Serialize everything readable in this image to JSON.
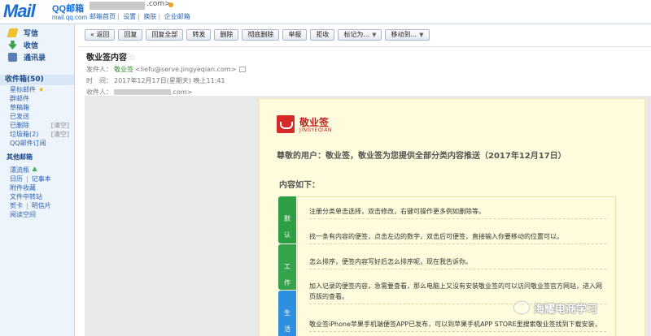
{
  "header": {
    "logo_text": "Mail",
    "logo_qq": "QQ邮箱",
    "logo_domain": "mail.qq.com",
    "account_suffix": ".com>",
    "links": [
      "邮箱首页",
      "设置",
      "换肤",
      "企业邮箱"
    ]
  },
  "sidebar": {
    "actions": [
      {
        "label": "写信",
        "icon": "pencil-icon"
      },
      {
        "label": "收信",
        "icon": "inbox-arrow-icon"
      },
      {
        "label": "通讯录",
        "icon": "contacts-icon"
      }
    ],
    "inbox_label": "收件箱(50)",
    "folders": [
      {
        "label": "星标邮件"
      },
      {
        "label": "群邮件"
      },
      {
        "label": "草稿箱"
      },
      {
        "label": "已发送"
      },
      {
        "label": "已删除",
        "clear": "[清空]"
      },
      {
        "label": "垃圾箱(2)",
        "clear": "[清空]"
      },
      {
        "label": "QQ邮件订阅"
      }
    ],
    "other_label": "其他邮箱",
    "tools": [
      {
        "label": "漂流瓶"
      },
      {
        "a": "日历",
        "b": "记事本"
      },
      {
        "label": "附件收藏"
      },
      {
        "label": "文件中转站"
      },
      {
        "a": "贺卡",
        "b": "明信片"
      },
      {
        "label": "阅读空间"
      }
    ]
  },
  "toolbar": {
    "buttons": [
      "« 返回",
      "回复",
      "回复全部",
      "转发",
      "删除",
      "彻底删除",
      "举报",
      "拒收"
    ],
    "mark_label": "标记为...",
    "move_label": "移动到..."
  },
  "email": {
    "subject": "敬业签内容",
    "from_label": "发件人：",
    "from_name": "敬业签",
    "from_addr": "<liefu@serve.jingyeqian.com>",
    "time_label": "时　间：",
    "time_value": "2017年12月17日(星期天) 晚上11:41",
    "to_label": "收件人：",
    "to_suffix": ".com>"
  },
  "letter": {
    "brand_name": "敬业签",
    "brand_sub": "JINGYEQIAN",
    "greeting": "尊敬的用户：敬业签，敬业签为您提供全部分类内容推送（2017年12月17日）",
    "content_heading": "内容如下：",
    "categories": [
      {
        "name": "默认",
        "color": "#2e9e45"
      },
      {
        "name": "工作",
        "color": "#34a34c"
      },
      {
        "name": "生活",
        "color": "#2d8fdd"
      }
    ],
    "rows": [
      "注册分类单击选择，双击修改，右键可操作更多例如删除等。",
      "找一条有内容的便签，点击左边的数字，双击后可便签，直接输入你要移动的位置可以。",
      "怎么排序，便签内容写好后怎么排序呢，现在我告诉你。",
      "加入记录的便签内容，急需要查看，那么电脑上又没有安装敬业签的可以访问敬业签官方网站，进入网页版的查看。",
      "敬业签iPhone苹果手机端便签APP已发布，可以到苹果手机APP STORE里搜索敬业签找到下载安装，"
    ]
  },
  "watermark": "海耀电商学习"
}
